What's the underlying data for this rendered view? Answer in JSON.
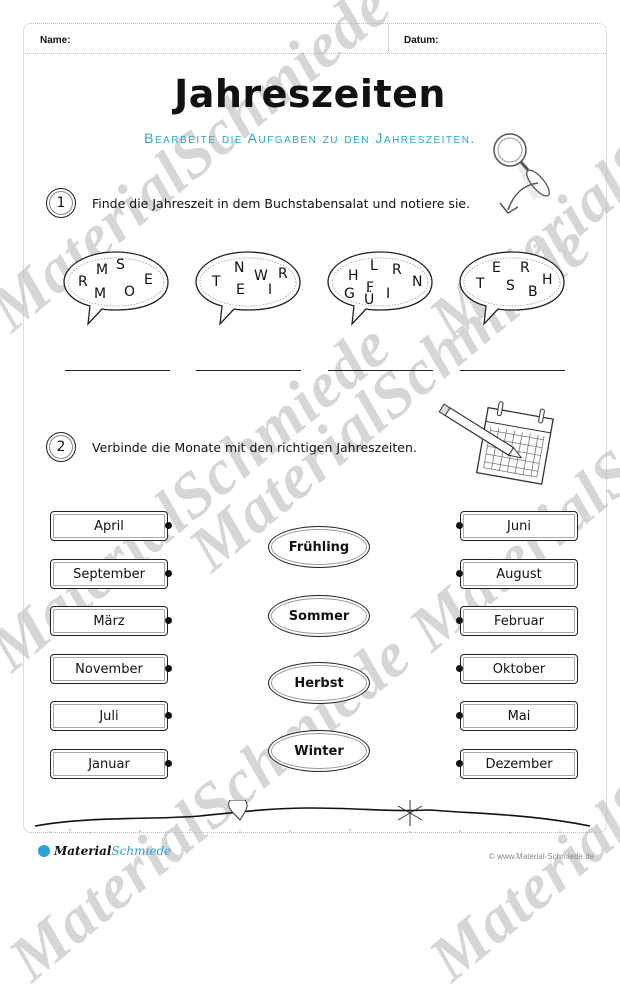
{
  "header": {
    "name_label": "Name:",
    "date_label": "Datum:"
  },
  "title": "Jahreszeiten",
  "subtitle": "Bearbeite die Aufgaben zu den Jahreszeiten.",
  "tasks": [
    {
      "number": "1",
      "text": "Finde die Jahreszeit in dem Buchstabensalat und notiere sie."
    },
    {
      "number": "2",
      "text": "Verbinde die Monate mit den richtigen Jahreszeiten."
    }
  ],
  "bubbles": [
    {
      "letters": [
        "M",
        "S",
        "R",
        "E",
        "M",
        "O"
      ]
    },
    {
      "letters": [
        "N",
        "T",
        "W",
        "R",
        "E",
        "I"
      ]
    },
    {
      "letters": [
        "H",
        "L",
        "R",
        "N",
        "G",
        "F",
        "Ü",
        "I"
      ]
    },
    {
      "letters": [
        "E",
        "R",
        "T",
        "S",
        "B",
        "H"
      ]
    }
  ],
  "months_left": [
    "April",
    "September",
    "März",
    "November",
    "Juli",
    "Januar"
  ],
  "months_right": [
    "Juni",
    "August",
    "Februar",
    "Oktober",
    "Mai",
    "Dezember"
  ],
  "seasons": [
    "Frühling",
    "Sommer",
    "Herbst",
    "Winter"
  ],
  "footer": {
    "logo_a": "Material",
    "logo_b": "Schmiede",
    "copyright": "© www.Material-Schmiede.de"
  },
  "watermark": "MaterialSchmiede",
  "colors": {
    "accent": "#2aa3d6"
  }
}
